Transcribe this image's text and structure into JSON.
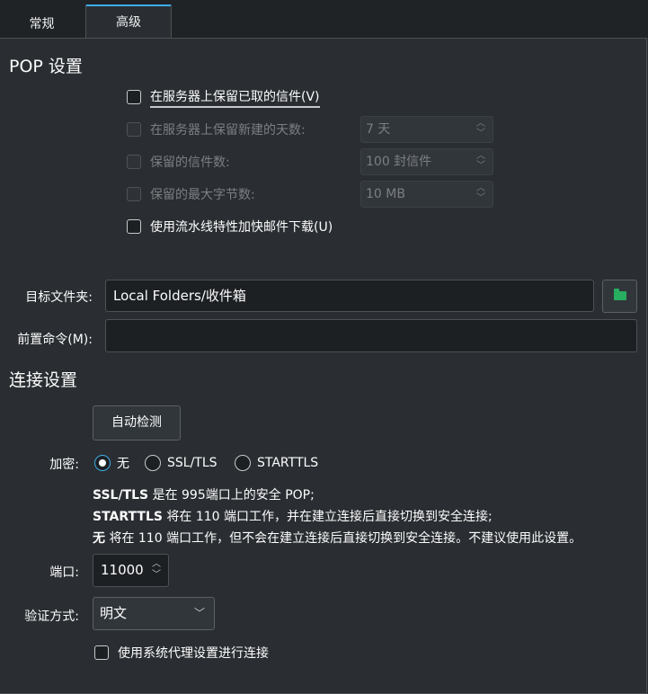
{
  "tabs": [
    {
      "label": "常规"
    },
    {
      "label": "高级"
    }
  ],
  "pop": {
    "title": "POP 设置",
    "keep_on_server": "在服务器上保留已取的信件(V)",
    "keep_days_label": "在服务器上保留新建的天数:",
    "keep_days_value": "7 天",
    "keep_count_label": "保留的信件数:",
    "keep_count_value": "100 封信件",
    "keep_size_label": "保留的最大字节数:",
    "keep_size_value": "10 MB",
    "pipelining": "使用流水线特性加快邮件下载(U)"
  },
  "target_folder": {
    "label": "目标文件夹:",
    "value": "Local Folders/收件箱",
    "button_icon": "folder-icon"
  },
  "precommand": {
    "label": "前置命令(M):",
    "value": ""
  },
  "connection": {
    "title": "连接设置",
    "autodetect": "自动检测",
    "encryption_label": "加密:",
    "encryption_options": [
      "无",
      "SSL/TLS",
      "STARTTLS"
    ],
    "encryption_selected": "无",
    "desc_ssl_bold": "SSL/TLS",
    "desc_ssl_rest": " 是在 995端口上的安全 POP;",
    "desc_starttls_bold": "STARTTLS",
    "desc_starttls_rest": " 将在 110 端口工作，并在建立连接后直接切换到安全连接;",
    "desc_none_bold": "无",
    "desc_none_rest": " 将在 110 端口工作，但不会在建立连接后直接切换到安全连接。不建议使用此设置。",
    "port_label": "端口:",
    "port_value": "11000",
    "auth_label": "验证方式:",
    "auth_value": "明文",
    "use_proxy": "使用系统代理设置进行连接"
  },
  "colors": {
    "accent": "#3daee9",
    "background": "#2a2e32",
    "folder_icon": "#27ae60"
  }
}
